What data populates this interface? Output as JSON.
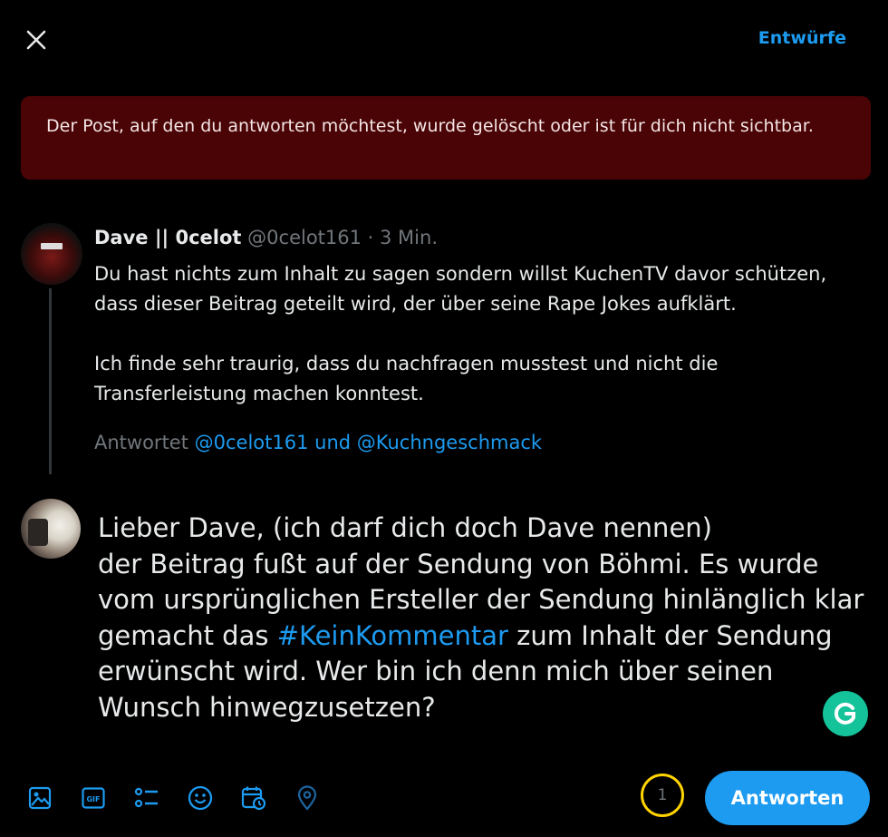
{
  "header": {
    "drafts_label": "Entwürfe"
  },
  "alert": {
    "text": "Der Post, auf den du antworten möchtest, wurde gelöscht oder ist für dich nicht sichtbar."
  },
  "original_post": {
    "author_name": "Dave || 0celot",
    "handle": "@0celot161",
    "separator": " · ",
    "time": "3 Min.",
    "paragraphs": [
      "Du hast nichts zum Inhalt zu sagen sondern willst KuchenTV davor schützen, dass dieser Beitrag geteilt wird, der über seine Rape Jokes aufklärt.",
      "Ich finde sehr traurig, dass du nachfragen musstest und nicht die Transferleistung machen konntest."
    ],
    "replying_prefix": "Antwortet ",
    "replying_to": "@0celot161 und @Kuchngeschmack"
  },
  "compose": {
    "line1": "Lieber Dave, (ich darf dich doch Dave nennen)",
    "text_before_hashtag": "der Beitrag fußt auf der Sendung von Böhmi. Es wurde vom ursprünglichen Ersteller der Sendung hinlänglich klar gemacht das ",
    "hashtag": "#KeinKommentar",
    "text_after_hashtag": " zum Inhalt der Sendung erwünscht wird. Wer bin ich denn mich über seinen Wunsch hinwegzusetzen?"
  },
  "toolbar": {
    "icons": [
      "image-icon",
      "gif-icon",
      "poll-icon",
      "emoji-icon",
      "schedule-icon",
      "location-icon"
    ],
    "gif_label": "GIF",
    "counter": "1",
    "reply_label": "Antworten"
  },
  "colors": {
    "accent": "#1d9bf0",
    "alert_bg": "#4a0406",
    "counter_ring": "#ffd400",
    "grammarly": "#15c39a"
  }
}
